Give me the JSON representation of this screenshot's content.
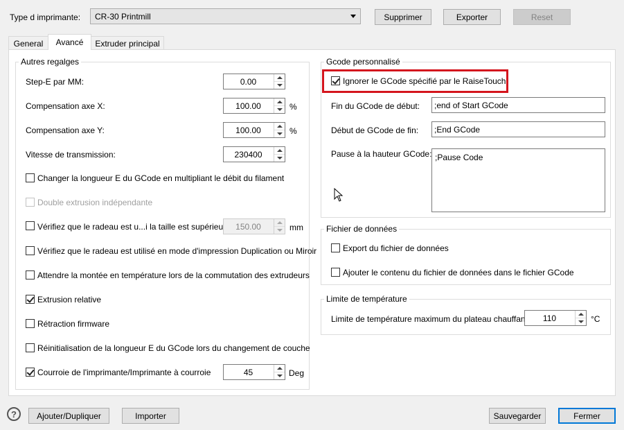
{
  "header": {
    "printer_type_label": "Type d imprimante:",
    "printer_selected": "CR-30 Printmill",
    "delete_button": "Supprimer",
    "export_button": "Exporter",
    "reset_button": "Reset"
  },
  "tabs": [
    {
      "label": "General"
    },
    {
      "label": "Avancé"
    },
    {
      "label": "Extruder principal"
    }
  ],
  "other_settings": {
    "title": "Autres regalges",
    "step_e": {
      "label": "Step-E par MM:",
      "value": "0.00"
    },
    "comp_x": {
      "label": "Compensation axe X:",
      "value": "100.00",
      "unit": "%"
    },
    "comp_y": {
      "label": "Compensation axe Y:",
      "value": "100.00",
      "unit": "%"
    },
    "baud": {
      "label": "Vitesse de transmission:",
      "value": "230400"
    },
    "chk_change_e": "Changer la longueur E du GCode en multipliant le débit du filament",
    "chk_double_extrusion": "Double extrusion indépendante",
    "chk_raft_size": "Vérifiez que le radeau est u...i la taille est supérieure à",
    "raft_size_value": "150.00",
    "raft_size_unit": "mm",
    "chk_raft_dup": "Vérifiez que le radeau est utilisé en mode d'impression Duplication ou Miroir",
    "chk_wait_temp": "Attendre la montée en température lors de la commutation des extrudeurs",
    "chk_relative": "Extrusion relative",
    "chk_retraction": "Rétraction firmware",
    "chk_reset_e": "Réinitialisation de la longueur E du GCode lors du changement de couche",
    "chk_belt": "Courroie de l'imprimante/Imprimante à courroie",
    "belt_value": "45",
    "belt_unit": "Deg"
  },
  "gcode": {
    "title": "Gcode personnalisé",
    "ignore_label": "Ignorer le GCode spécifié par le RaiseTouch",
    "start_end_label": "Fin du GCode de début:",
    "start_end_value": ";end of Start GCode",
    "end_start_label": "Début de GCode de fin:",
    "end_start_value": ";End GCode",
    "pause_label": "Pause à la hauteur GCode:",
    "pause_value": ";Pause Code"
  },
  "data_file": {
    "title": "Fichier de données",
    "export_label": "Export du fichier de données",
    "append_label": "Ajouter le contenu du fichier de données dans le fichier GCode"
  },
  "temp_limit": {
    "title": "Limite de température",
    "label": "Limite de température maximum du plateau chauffant:",
    "value": "110",
    "unit": "°C"
  },
  "footer": {
    "help": "?",
    "add_dup_button": "Ajouter/Dupliquer",
    "import_button": "Importer",
    "save_button": "Sauvegarder",
    "close_button": "Fermer"
  },
  "colors": {
    "highlight": "#d4151d",
    "accent": "#0078d7"
  }
}
